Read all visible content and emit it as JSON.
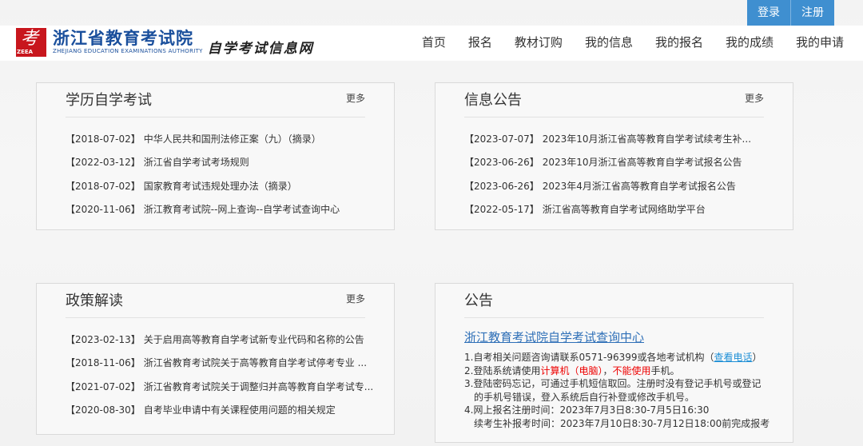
{
  "auth": {
    "login": "登录",
    "register": "注册"
  },
  "header": {
    "logo_glyph": "考",
    "logo_abbr": "ZEEA",
    "logo_cn": "浙江省教育考试院",
    "logo_en": "ZHEJIANG EDUCATION EXAMINATIONS AUTHORITY",
    "site_name": "自学考试信息网"
  },
  "nav": [
    "首页",
    "报名",
    "教材订购",
    "我的信息",
    "我的报名",
    "我的成绩",
    "我的申请"
  ],
  "panels": {
    "exam": {
      "title": "学历自学考试",
      "more": "更多",
      "items": [
        {
          "date": "【2018-07-02】",
          "text": "中华人民共和国刑法修正案（九）（摘录）"
        },
        {
          "date": "【2022-03-12】",
          "text": "浙江省自学考试考场规则"
        },
        {
          "date": "【2018-07-02】",
          "text": "国家教育考试违规处理办法（摘录）"
        },
        {
          "date": "【2020-11-06】",
          "text": "浙江教育考试院--网上查询--自学考试查询中心"
        }
      ]
    },
    "info": {
      "title": "信息公告",
      "more": "更多",
      "items": [
        {
          "date": "【2023-07-07】",
          "text": "2023年10月浙江省高等教育自学考试续考生补..."
        },
        {
          "date": "【2023-06-26】",
          "text": "2023年10月浙江省高等教育自学考试报名公告"
        },
        {
          "date": "【2023-06-26】",
          "text": "2023年4月浙江省高等教育自学考试报名公告"
        },
        {
          "date": "【2022-05-17】",
          "text": "浙江省高等教育自学考试网络助学平台"
        }
      ]
    },
    "policy": {
      "title": "政策解读",
      "more": "更多",
      "items": [
        {
          "date": "【2023-02-13】",
          "text": "关于启用高等教育自学考试新专业代码和名称的公告"
        },
        {
          "date": "【2018-11-06】",
          "text": "浙江省教育考试院关于高等教育自学考试停考专业 ..."
        },
        {
          "date": "【2021-07-02】",
          "text": "浙江省教育考试院关于调整归并高等教育自学考试专..."
        },
        {
          "date": "【2020-08-30】",
          "text": "自考毕业申请中有关课程使用问题的相关规定"
        }
      ]
    },
    "notice": {
      "title": "公告",
      "link": "浙江教育考试院自学考试查询中心",
      "l1a": "1.自考相关问题咨询请联系0571-96399或各地考试机构（",
      "l1b": "查看电话",
      "l1c": "）",
      "l2a": "2.登陆系统请使用",
      "l2b": "计算机（电脑）",
      "l2c": "，",
      "l2d": "不能使用",
      "l2e": "手机。",
      "l3": "3.登陆密码忘记，可通过手机短信取回。注册时没有登记手机号或登记",
      "l3b": "的手机号错误，登入系统后自行补登或修改手机号。",
      "l4": "4.网上报名注册时间：2023年7月3日8:30-7月5日16:30",
      "l4b": "续考生补报考时间：2023年7月10日8:30-7月12日18:00前完成报考"
    }
  }
}
